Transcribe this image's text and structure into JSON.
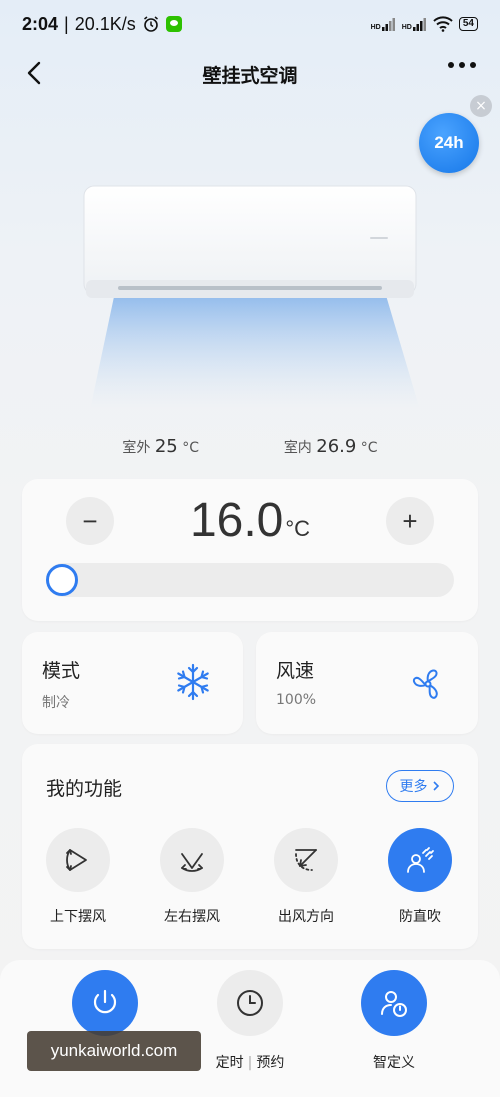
{
  "status_bar": {
    "time": "2:04",
    "network_speed": "20.1K/s",
    "signal_1_label": "HD",
    "signal_2_label": "HD",
    "battery": "54"
  },
  "header": {
    "title": "壁挂式空调"
  },
  "service_badge": "24h",
  "climate": {
    "outdoor_label": "室外",
    "outdoor_value": "25",
    "indoor_label": "室内",
    "indoor_value": "26.9",
    "unit": "°C"
  },
  "temperature": {
    "value": "16.0",
    "unit": "°C",
    "minus": "−",
    "plus": "+",
    "slider_level": 0
  },
  "mode": {
    "title": "模式",
    "value": "制冷",
    "icon": "snowflake-icon"
  },
  "fan_speed": {
    "title": "风速",
    "value": "100%",
    "icon": "fan-icon"
  },
  "functions": {
    "title": "我的功能",
    "more_label": "更多",
    "items": [
      {
        "label": "上下摆风",
        "icon": "vertical-swing-icon",
        "active": false
      },
      {
        "label": "左右摆风",
        "icon": "horizontal-swing-icon",
        "active": false
      },
      {
        "label": "出风方向",
        "icon": "airflow-direction-icon",
        "active": false
      },
      {
        "label": "防直吹",
        "icon": "anti-direct-blow-icon",
        "active": true
      }
    ]
  },
  "bottom_bar": {
    "power_icon": "power-icon",
    "schedule_label_1": "定时",
    "schedule_label_2": "预约",
    "custom_label": "智定义"
  },
  "watermark": "yunkaiworld.com",
  "colors": {
    "accent": "#2f7cf0",
    "card_bg": "#fafafa",
    "button_bg": "#ececec"
  }
}
